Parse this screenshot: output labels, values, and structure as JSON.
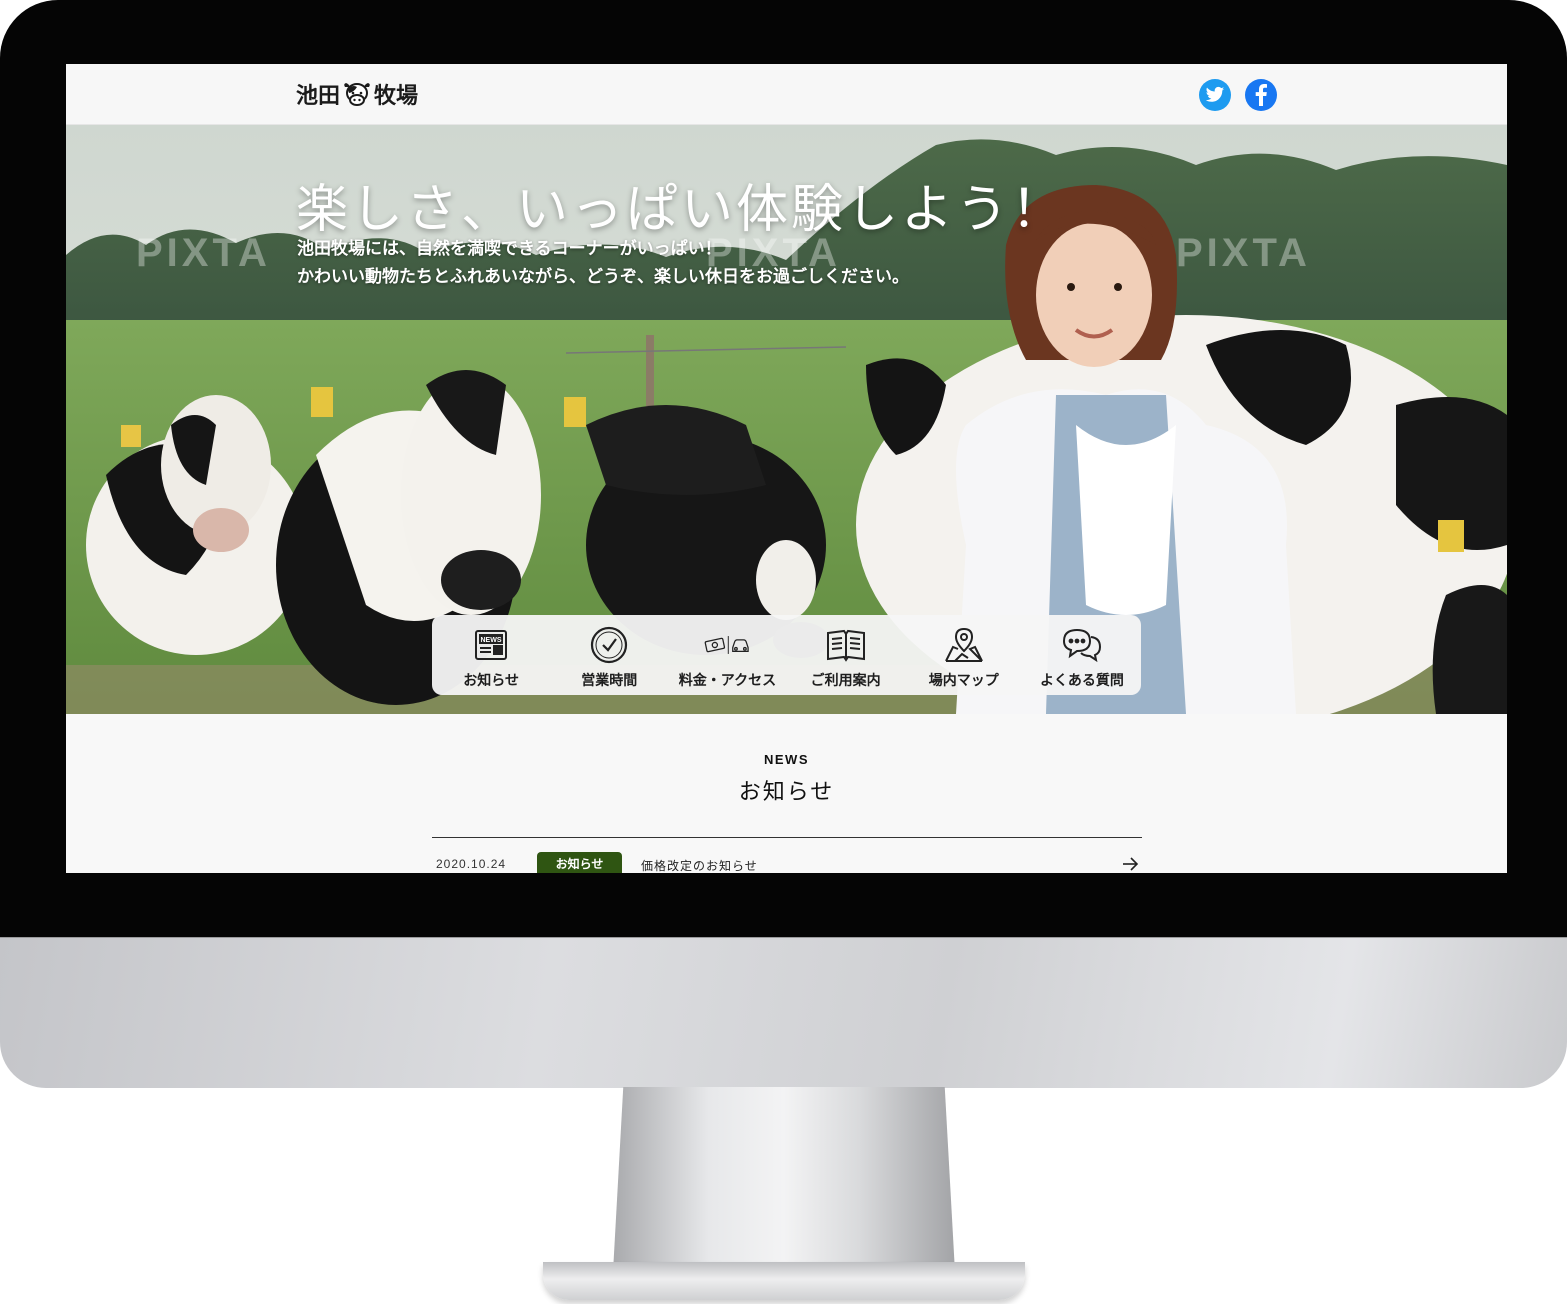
{
  "site": {
    "logo_text_left": "池田",
    "logo_text_right": "牧場",
    "social": [
      {
        "name": "twitter",
        "icon": "twitter-icon",
        "color": "#1d9bf0"
      },
      {
        "name": "facebook",
        "icon": "facebook-icon",
        "color": "#1877f2"
      }
    ]
  },
  "hero": {
    "title": "楽しさ、いっぱい体験しよう！",
    "lead_line1": "池田牧場には、自然を満喫できるコーナーがいっぱい！",
    "lead_line2": "かわいい動物たちとふれあいながら、どうぞ、楽しい休日をお過ごしください。",
    "watermark": "PIXTA"
  },
  "quick_nav": [
    {
      "label": "お知らせ",
      "icon": "newspaper-icon"
    },
    {
      "label": "営業時間",
      "icon": "clock-icon"
    },
    {
      "label": "料金・アクセス",
      "icon": "money-car-icon"
    },
    {
      "label": "ご利用案内",
      "icon": "book-icon"
    },
    {
      "label": "場内マップ",
      "icon": "map-pin-icon"
    },
    {
      "label": "よくある質問",
      "icon": "chat-bubbles-icon"
    }
  ],
  "news": {
    "eyebrow": "NEWS",
    "title": "お知らせ",
    "items": [
      {
        "date": "2020.10.24",
        "category": "お知らせ",
        "text": "価格改定のお知らせ"
      }
    ]
  },
  "colors": {
    "news_badge": "#2f5512",
    "hero_text": "#ffffff",
    "bezel": "#050505"
  }
}
